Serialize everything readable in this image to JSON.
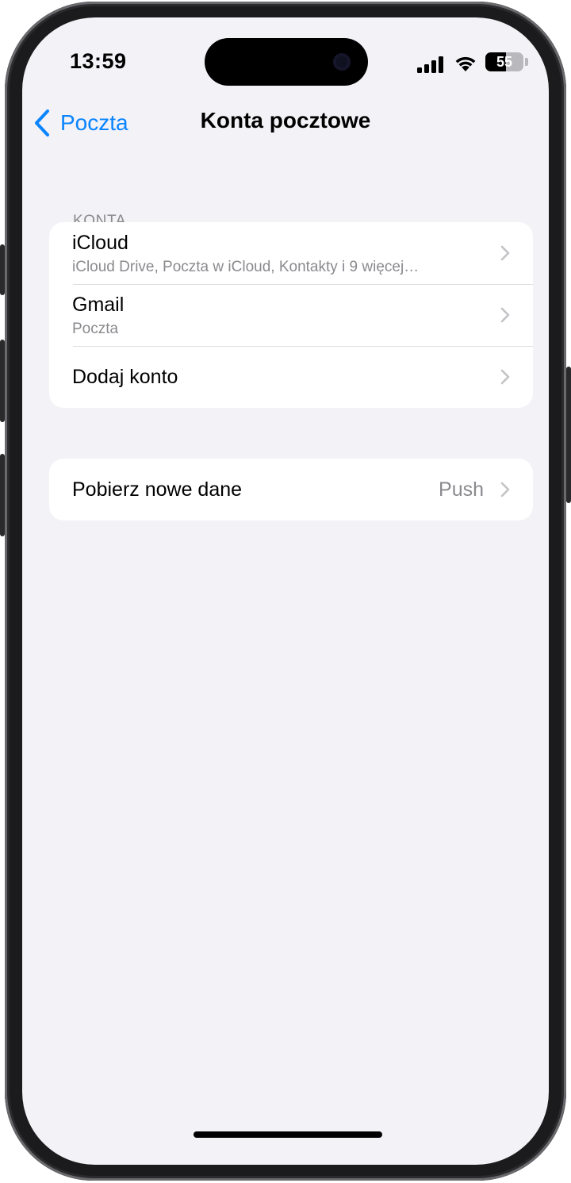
{
  "status_bar": {
    "time": "13:59",
    "battery_level": 55,
    "battery_text": "55"
  },
  "nav": {
    "back_label": "Poczta",
    "title": "Konta pocztowe"
  },
  "accounts_section": {
    "header": "KONTA",
    "items": [
      {
        "title": "iCloud",
        "subtitle": "iCloud Drive, Poczta w iCloud, Kontakty i 9 więcej…"
      },
      {
        "title": "Gmail",
        "subtitle": "Poczta"
      },
      {
        "title": "Dodaj konto"
      }
    ]
  },
  "fetch_section": {
    "title": "Pobierz nowe dane",
    "value": "Push"
  },
  "colors": {
    "accent": "#0a84ff",
    "background": "#f2f2f7",
    "secondary_text": "#8a8a8e"
  }
}
